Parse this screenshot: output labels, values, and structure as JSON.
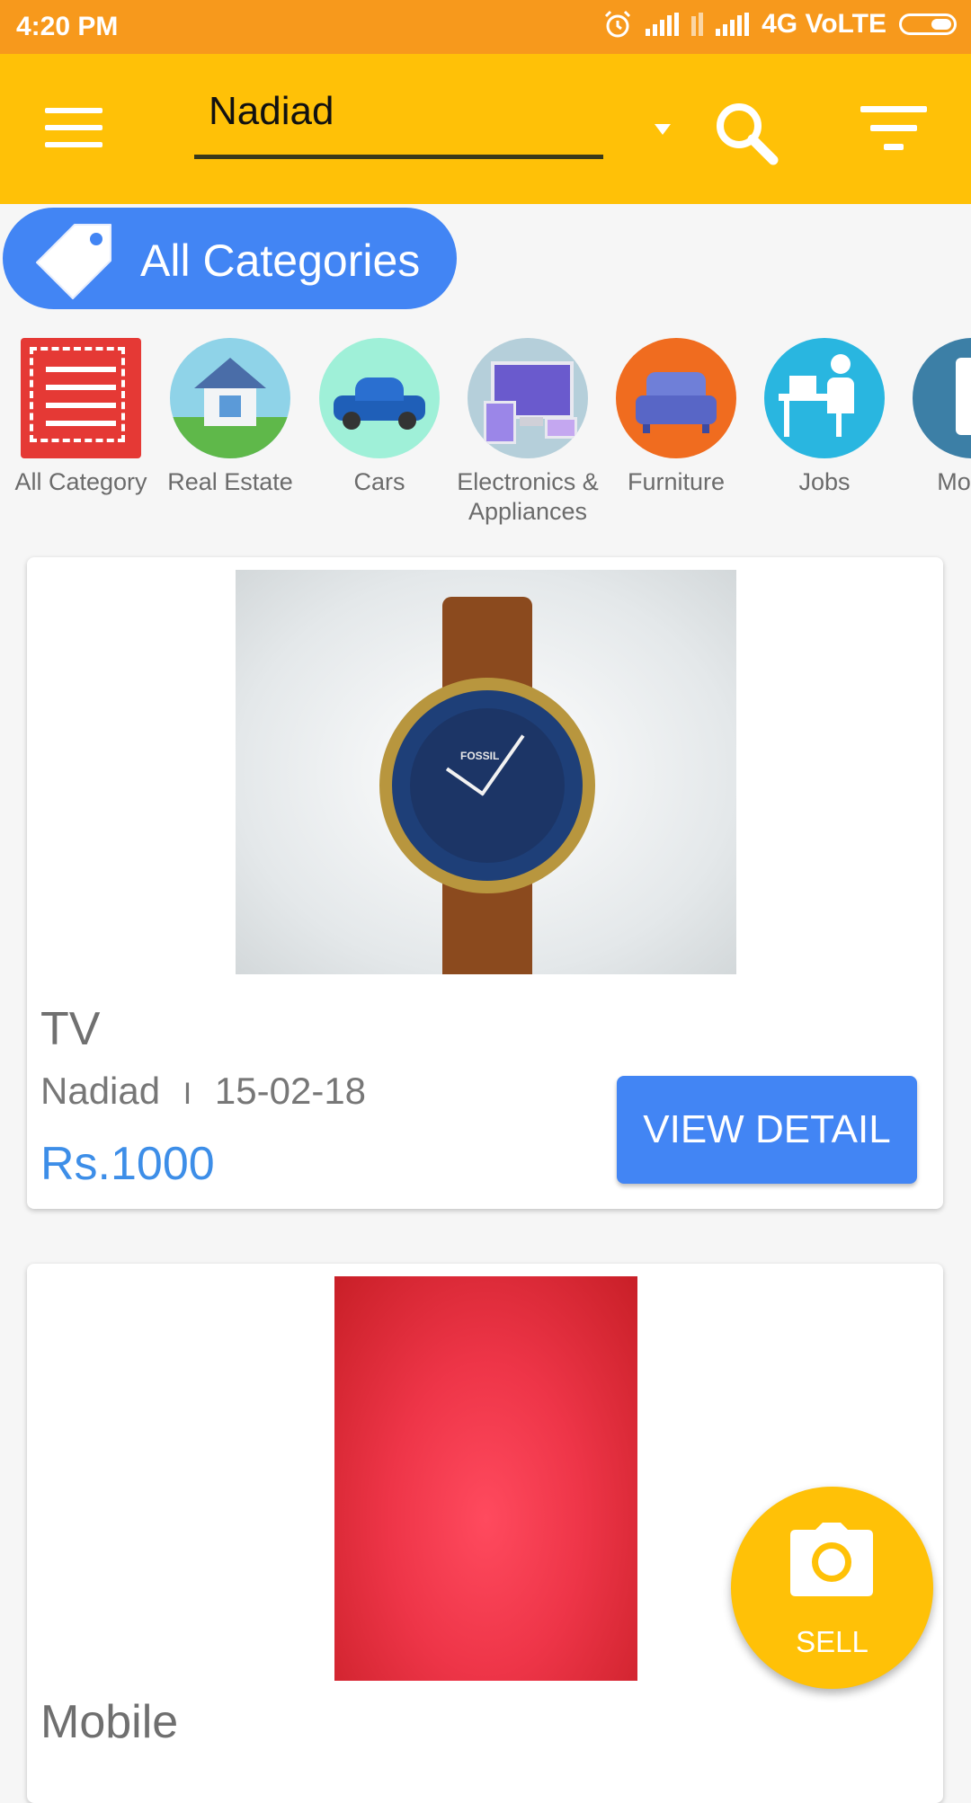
{
  "status_bar": {
    "time": "4:20 PM",
    "network": "4G VoLTE"
  },
  "app_bar": {
    "city_value": "Nadiad",
    "icons": [
      "menu-icon",
      "dropdown-arrow-icon",
      "search-icon",
      "filter-icon"
    ]
  },
  "category_chip": {
    "label": "All Categories",
    "icon": "tag-icon"
  },
  "categories": [
    {
      "label": "All Category",
      "icon": "list-icon",
      "color": "#E53935"
    },
    {
      "label": "Real Estate",
      "icon": "house-icon",
      "color": "#8fd3e8"
    },
    {
      "label": "Cars",
      "icon": "car-icon",
      "color": "#9ff0d8"
    },
    {
      "label": "Electronics & Appliances",
      "icon": "monitor-icon",
      "color": "#b5cfda"
    },
    {
      "label": "Furniture",
      "icon": "sofa-icon",
      "color": "#F06C1F"
    },
    {
      "label": "Jobs",
      "icon": "desk-worker-icon",
      "color": "#29B6E0"
    },
    {
      "label": "Mobile",
      "icon": "phone-icon",
      "color": "#3c7fa6"
    }
  ],
  "listings": [
    {
      "title": "TV",
      "location": "Nadiad",
      "separator": "I",
      "date": "15-02-18",
      "price": "Rs.1000",
      "button": "VIEW DETAIL",
      "image_brand": "FOSSIL"
    },
    {
      "title": "Mobile"
    }
  ],
  "fab": {
    "label": "SELL",
    "icon": "camera-icon"
  },
  "colors": {
    "status_bar": "#F7991C",
    "app_bar": "#FFC107",
    "accent_blue": "#4285F4",
    "price_blue": "#3d8ee8"
  }
}
